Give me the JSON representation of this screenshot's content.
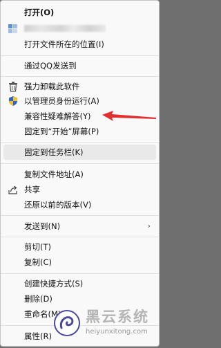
{
  "menu": {
    "items": [
      {
        "label": "打开(O)"
      },
      {
        "label": "打开文件所在的位置(I)"
      },
      {
        "label": "通过QQ发送到"
      },
      {
        "label": "强力卸载此软件"
      },
      {
        "label": "以管理员身份运行(A)"
      },
      {
        "label": "兼容性疑难解答(Y)"
      },
      {
        "label": "固定到“开始”屏幕(P)"
      },
      {
        "label": "固定到任务栏(K)"
      },
      {
        "label": "复制文件地址(A)"
      },
      {
        "label": "共享"
      },
      {
        "label": "还原以前的版本(V)"
      },
      {
        "label": "发送到(N)"
      },
      {
        "label": "剪切(T)"
      },
      {
        "label": "复制(C)"
      },
      {
        "label": "创建快捷方式(S)"
      },
      {
        "label": "删除(D)"
      },
      {
        "label": "重命名(M)"
      },
      {
        "label": "属性(R)"
      }
    ],
    "submenu_chevron": "›",
    "icons": [
      "app-icon",
      "trash-icon",
      "uac-shield-icon",
      "share-icon",
      "chevron-right-icon"
    ]
  },
  "annotation": {
    "arrow_color": "#e03030"
  },
  "watermark": {
    "title": "黑云系统",
    "url": "heiyunxitong.com"
  }
}
